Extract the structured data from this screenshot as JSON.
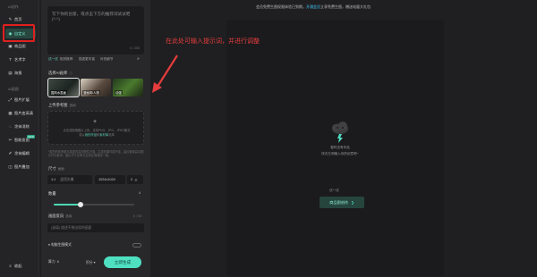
{
  "nav": {
    "group_top": "AI创作",
    "items_top": [
      {
        "label": "首页",
        "icon": "draw-icon"
      },
      {
        "label": "自定义",
        "icon": "palette-icon"
      },
      {
        "label": "商品图",
        "icon": "box-icon"
      },
      {
        "label": "艺术字",
        "icon": "font-icon"
      },
      {
        "label": "海报",
        "icon": "poster-icon"
      }
    ],
    "group_tools": "AI画图",
    "items_tools": [
      {
        "label": "图片扩展",
        "icon": "expand-icon"
      },
      {
        "label": "图片变高清",
        "icon": "hd-icon"
      },
      {
        "label": "涂抹消除",
        "icon": "eraser-icon"
      },
      {
        "label": "智能抠图",
        "icon": "cutout-icon",
        "badge": "NEW"
      },
      {
        "label": "涂抹编辑",
        "icon": "brush-icon"
      },
      {
        "label": "图片叠加",
        "icon": "layers-icon"
      }
    ],
    "bottom_label": "收起"
  },
  "prompt": {
    "placeholder": "写下你的创意，或点击下方的推荐词试试吧(^-^)",
    "counter": "0 / 200"
  },
  "prompt_tools": {
    "try": "试一试",
    "related": "相关推荐",
    "enhance": "描述更丰富",
    "detail": "补充细节"
  },
  "style_section": {
    "title": "选择AI画师",
    "info": "ⓘ"
  },
  "styles": [
    {
      "label": "国风水墨画"
    },
    {
      "label": "漫画风/人物"
    },
    {
      "label": "动漫"
    }
  ],
  "upload": {
    "title": "上传参考图",
    "sub": "选填",
    "plus": "+",
    "line1": "点击或拖拽图片上传，支持PNG、JPG、JPEG格式",
    "line2": "或从",
    "link1": "我的作品",
    "sep": "和",
    "link2": "素材库",
    "line3": "选择"
  },
  "note": "*若您的参考图与描述内容关联性不强，生成效果可能不佳，建议使用高清图片作为参考，图片尺寸比例与生成比例保持一致。",
  "size": {
    "title": "尺寸",
    "sub": "画面",
    "ratio": "1:1",
    "ratio_hint": "适用头像",
    "resolution": "1024x1024",
    "count": "2"
  },
  "quantity": {
    "title": "数量",
    "value": "4",
    "fraction": 0.33
  },
  "negative": {
    "title": "画面反向",
    "sub": "选填",
    "counter": "0 / 50",
    "placeholder": "(选填) 描述不想出现的画面"
  },
  "speed_mode": {
    "label": "电脑生图模式"
  },
  "footer": {
    "points_label": "算力:",
    "points_value": "8",
    "tier_label": "积分",
    "generate": "立即生成"
  },
  "topbar": {
    "message": "会员免费生图权限体验已到期，",
    "link1": "开通会员",
    "message2": "立享免费生图，赠送电量大礼包"
  },
  "canvas": {
    "empty_line1": "暂时没有作品",
    "empty_line2": "快去左侧输入你的创意吧~",
    "try_label": "试一试",
    "sample_button": "商品图创作"
  },
  "annotation": {
    "text": "在此处可输入提示词，并进行调整",
    "color": "#e53c3c"
  },
  "colors": {
    "accent": "#4fe0c2",
    "highlight": "#e02020"
  }
}
